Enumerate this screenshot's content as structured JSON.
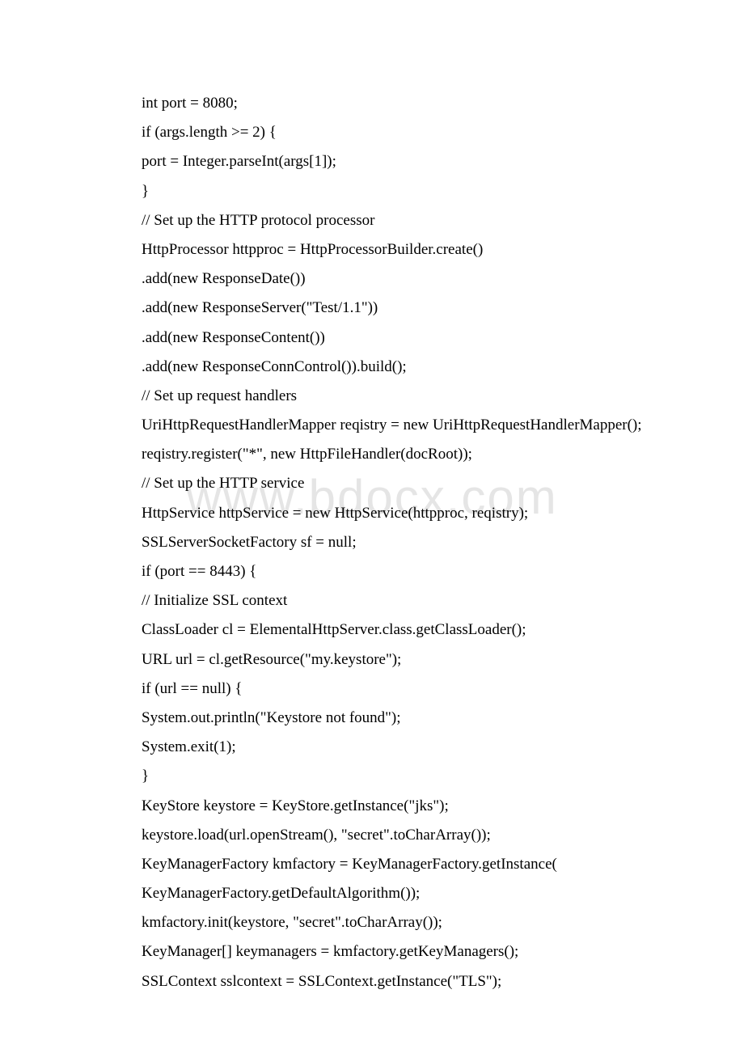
{
  "watermark": "www.bdocx.com",
  "lines": [
    "int port = 8080;",
    "if (args.length >= 2) {",
    "port = Integer.parseInt(args[1]);",
    "}",
    "// Set up the HTTP protocol processor",
    "HttpProcessor httpproc = HttpProcessorBuilder.create()",
    ".add(new ResponseDate())",
    ".add(new ResponseServer(\"Test/1.1\"))",
    ".add(new ResponseContent())",
    ".add(new ResponseConnControl()).build();",
    "// Set up request handlers",
    "UriHttpRequestHandlerMapper reqistry = new UriHttpRequestHandlerMapper();",
    "reqistry.register(\"*\", new HttpFileHandler(docRoot));",
    "// Set up the HTTP service",
    "HttpService httpService = new HttpService(httpproc, reqistry);",
    "SSLServerSocketFactory sf = null;",
    "if (port == 8443) {",
    "// Initialize SSL context",
    "ClassLoader cl = ElementalHttpServer.class.getClassLoader();",
    "URL url = cl.getResource(\"my.keystore\");",
    "if (url == null) {",
    "System.out.println(\"Keystore not found\");",
    "System.exit(1);",
    "}",
    "KeyStore keystore = KeyStore.getInstance(\"jks\");",
    "keystore.load(url.openStream(), \"secret\".toCharArray());",
    "KeyManagerFactory kmfactory = KeyManagerFactory.getInstance(",
    "KeyManagerFactory.getDefaultAlgorithm());",
    "kmfactory.init(keystore, \"secret\".toCharArray());",
    "KeyManager[] keymanagers = kmfactory.getKeyManagers();",
    "SSLContext sslcontext = SSLContext.getInstance(\"TLS\");"
  ]
}
